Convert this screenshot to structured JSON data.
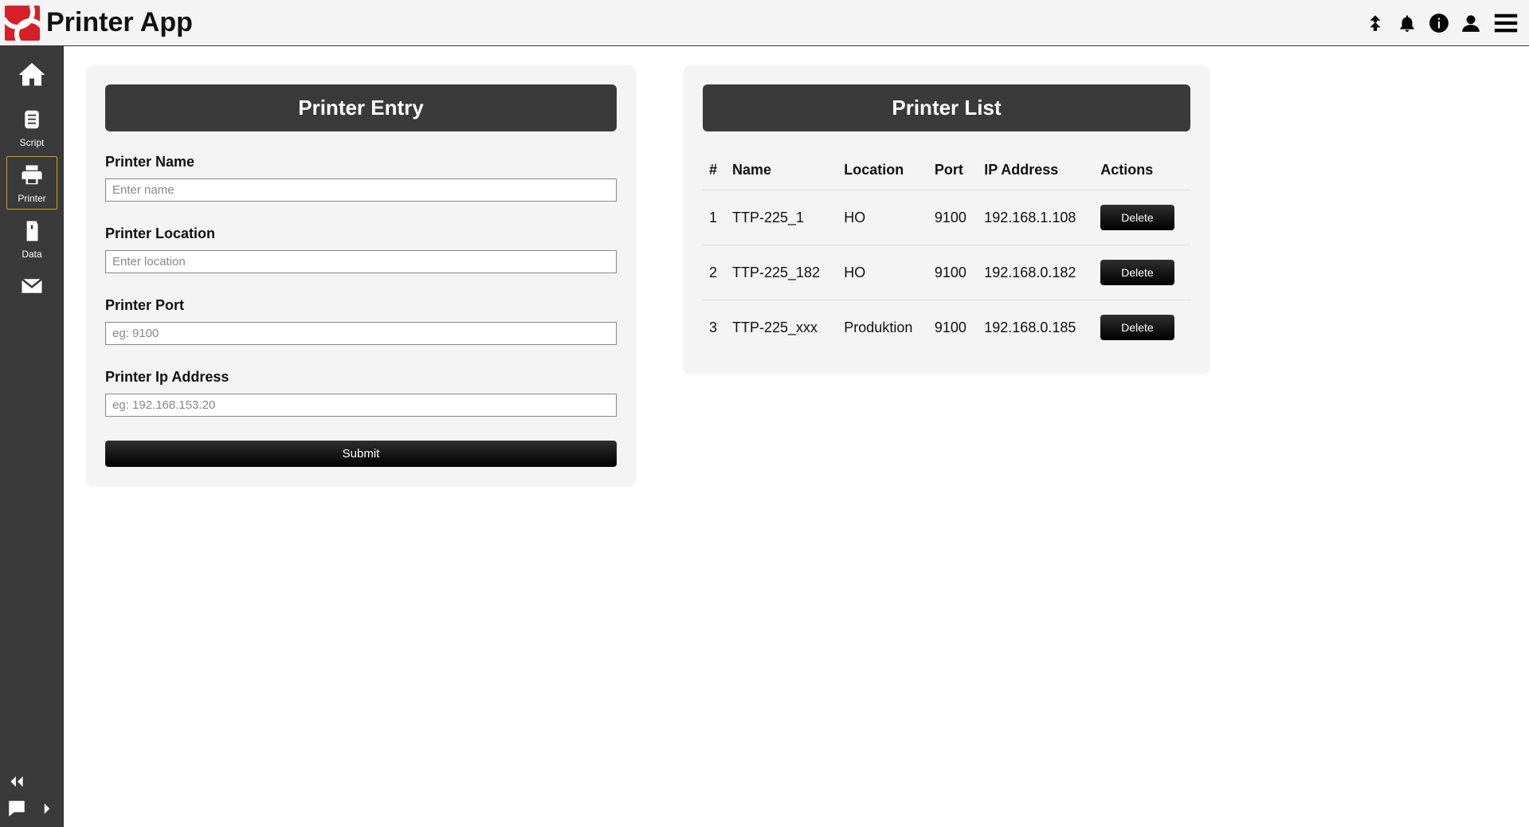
{
  "header": {
    "title": "Printer App"
  },
  "sidebar": {
    "items": [
      {
        "label": "",
        "icon": "home"
      },
      {
        "label": "Script",
        "icon": "script"
      },
      {
        "label": "Printer",
        "icon": "printer",
        "active": true
      },
      {
        "label": "Data",
        "icon": "data"
      },
      {
        "label": "",
        "icon": "mail"
      }
    ]
  },
  "entry_panel": {
    "title": "Printer Entry",
    "fields": {
      "name": {
        "label": "Printer Name",
        "placeholder": "Enter name"
      },
      "location": {
        "label": "Printer Location",
        "placeholder": "Enter location"
      },
      "port": {
        "label": "Printer Port",
        "placeholder": "eg: 9100"
      },
      "ip": {
        "label": "Printer Ip Address",
        "placeholder": "eg: 192.168.153.20"
      }
    },
    "submit_label": "Submit"
  },
  "list_panel": {
    "title": "Printer List",
    "columns": [
      "#",
      "Name",
      "Location",
      "Port",
      "IP Address",
      "Actions"
    ],
    "delete_label": "Delete",
    "rows": [
      {
        "num": "1",
        "name": "TTP-225_1",
        "location": "HO",
        "port": "9100",
        "ip": "192.168.1.108"
      },
      {
        "num": "2",
        "name": "TTP-225_182",
        "location": "HO",
        "port": "9100",
        "ip": "192.168.0.182"
      },
      {
        "num": "3",
        "name": "TTP-225_xxx",
        "location": "Produktion",
        "port": "9100",
        "ip": "192.168.0.185"
      }
    ]
  }
}
